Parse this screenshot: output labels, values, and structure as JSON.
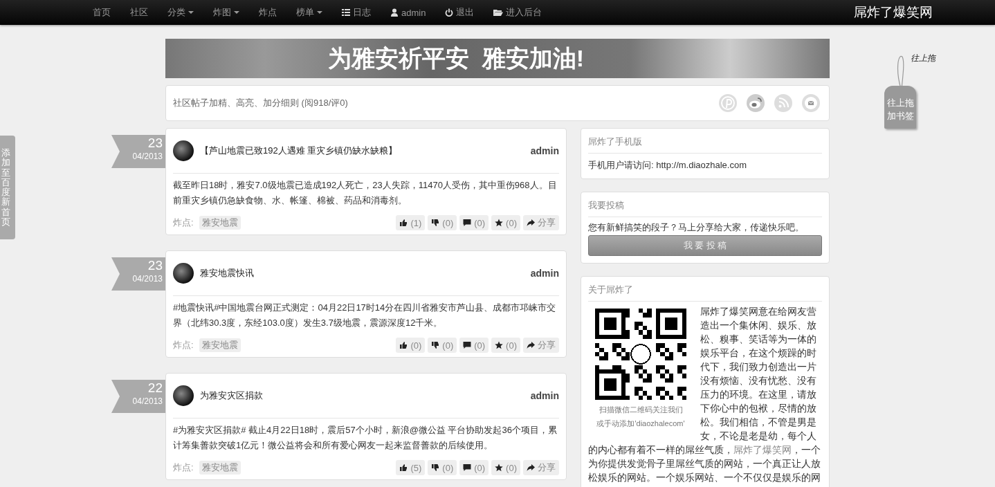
{
  "navbar": {
    "items": [
      {
        "label": "首页",
        "kind": "text",
        "dropdown": false
      },
      {
        "label": "社区",
        "kind": "text",
        "dropdown": false
      },
      {
        "label": "分类",
        "kind": "text",
        "dropdown": true
      },
      {
        "label": "炸图",
        "kind": "text",
        "dropdown": true
      },
      {
        "label": "炸点",
        "kind": "text",
        "dropdown": false
      },
      {
        "label": "榜单",
        "kind": "text",
        "dropdown": true
      },
      {
        "label": "日志",
        "kind": "log",
        "dropdown": false
      },
      {
        "label": "admin",
        "kind": "user",
        "dropdown": false
      },
      {
        "label": "退出",
        "kind": "logout",
        "dropdown": false
      },
      {
        "label": "进入后台",
        "kind": "admin",
        "dropdown": false
      }
    ],
    "brand": "屌炸了爆笑网"
  },
  "side_tab": {
    "label": "添加至百度新首页"
  },
  "bookmark": {
    "hint": "往上拖",
    "tag": "往上拖加书签"
  },
  "banner": {
    "text": "为雅安祈平安  雅安加油!"
  },
  "notice": {
    "text": "社区帖子加精、高亮、加分细则 (阅918/评0)"
  },
  "posts": [
    {
      "day": "23",
      "month": "04/2013",
      "title": "【芦山地震已致192人遇难 重灾乡镇仍缺水缺粮】",
      "author": "admin",
      "body": "截至昨日18时，雅安7.0级地震已造成192人死亡，23人失踪，11470人受伤，其中重伤968人。目前重灾乡镇仍急缺食物、水、帐篷、棉被、药品和消毒剂。",
      "tag_label": "炸点:",
      "tag": "雅安地震",
      "actions": [
        {
          "kind": "up",
          "text": "(1)"
        },
        {
          "kind": "down",
          "text": "(0)"
        },
        {
          "kind": "comment",
          "text": "(0)"
        },
        {
          "kind": "star",
          "text": "(0)"
        },
        {
          "kind": "share",
          "text": "分享"
        }
      ]
    },
    {
      "day": "23",
      "month": "04/2013",
      "title": "雅安地震快讯",
      "author": "admin",
      "body": "#地震快讯#中国地震台网正式测定：04月22日17时14分在四川省雅安市芦山县、成都市邛崃市交界（北纬30.3度，东经103.0度）发生3.7级地震，震源深度12千米。",
      "tag_label": "炸点:",
      "tag": "雅安地震",
      "actions": [
        {
          "kind": "up",
          "text": "(0)"
        },
        {
          "kind": "down",
          "text": "(0)"
        },
        {
          "kind": "comment",
          "text": "(0)"
        },
        {
          "kind": "star",
          "text": "(0)"
        },
        {
          "kind": "share",
          "text": "分享"
        }
      ]
    },
    {
      "day": "22",
      "month": "04/2013",
      "title": "为雅安灾区捐款",
      "author": "admin",
      "body": "#为雅安灾区捐款# 截止4月22日18时，震后57个小时，新浪@微公益 平台协助发起36个项目，累计筹集善款突破1亿元！微公益将会和所有爱心网友一起来监督善款的后续使用。",
      "tag_label": "炸点:",
      "tag": "雅安地震",
      "actions": [
        {
          "kind": "up",
          "text": "(5)"
        },
        {
          "kind": "down",
          "text": "(0)"
        },
        {
          "kind": "comment",
          "text": "(0)"
        },
        {
          "kind": "star",
          "text": "(0)"
        },
        {
          "kind": "share",
          "text": "分享"
        }
      ]
    }
  ],
  "sidebar": {
    "mobile": {
      "title": "屌炸了手机版",
      "text": "手机用户请访问: http://m.diaozhale.com"
    },
    "submit": {
      "title": "我要投稿",
      "text": "您有新鲜搞笑的段子？马上分享给大家，传递快乐吧。",
      "button": "我 要 投 稿"
    },
    "about": {
      "title": "关于屌炸了",
      "qr_caption": [
        "扫描微信二维码关注我们",
        "或手动添加'diaozhalecom'"
      ],
      "text_side": "屌炸了爆笑网意在给网友营造出一个集休闲、娱乐、放松、糗事、笑话等为一体的娱乐平台，在这个烦躁的时代下，我们致力创造出一片没有烦恼、没有忧愁、没有压力的环境。在这里，请放下你心中的包袱，尽情的放松。我们相信，不管是男是女，不论是老是幼，每个人",
      "text_before": "的内心都有着不一样的屌丝气质，",
      "link": "屌炸了爆笑网",
      "text_after": "，一个为你提供发觉骨子里屌丝气质的网站，一个真正让人放松娱乐的网站。一个娱乐网站、一个不仅仅是娱乐的网"
    }
  }
}
